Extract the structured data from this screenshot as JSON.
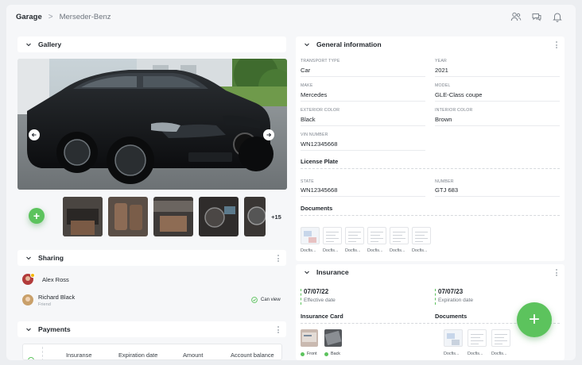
{
  "breadcrumb": {
    "root": "Garage",
    "separator": ">",
    "current": "Merseder-Benz"
  },
  "gallery": {
    "title": "Gallery",
    "more_count": "+15",
    "prev_icon": "arrow-left-icon",
    "next_icon": "arrow-right-icon"
  },
  "sharing": {
    "title": "Sharing",
    "people": [
      {
        "name": "Alex Ross",
        "role": ""
      },
      {
        "name": "Richard Black",
        "role": "Friend",
        "permission": "Can view"
      }
    ]
  },
  "payments": {
    "title": "Payments",
    "columns": [
      "Insuranse",
      "Expiration date",
      "Amount",
      "Account balance"
    ]
  },
  "general": {
    "title": "General information",
    "fields": {
      "transport_type": {
        "label": "TRANSPORT TYPE",
        "value": "Car"
      },
      "year": {
        "label": "YEAR",
        "value": "2021"
      },
      "make": {
        "label": "MAKE",
        "value": "Mercedes"
      },
      "model": {
        "label": "MODEL",
        "value": "GLE-Class coupe"
      },
      "exterior_color": {
        "label": "EXTERIOR COLOR",
        "value": "Black"
      },
      "interior_color": {
        "label": "INTERIOR COLOR",
        "value": "Brown"
      },
      "vin": {
        "label": "VIN NUMBER",
        "value": "WN12345668"
      }
    },
    "license_plate": {
      "title": "License Plate",
      "state": {
        "label": "STATE",
        "value": "WN12345668"
      },
      "number": {
        "label": "NUMBER",
        "value": "GTJ 683"
      }
    },
    "documents": {
      "title": "Documents",
      "files": [
        "Docfis...",
        "Docfis...",
        "Docfis...",
        "Docfis...",
        "Docfis...",
        "Docfis..."
      ]
    }
  },
  "insurance": {
    "title": "Insurance",
    "effective": {
      "date": "07/07/22",
      "label": "Effective date"
    },
    "expiration": {
      "date": "07/07/23",
      "label": "Expiration date"
    },
    "card": {
      "title": "Insurance Card",
      "front": "Front",
      "back": "Back"
    },
    "documents": {
      "title": "Documents",
      "files": [
        "Docfis...",
        "Docfis...",
        "Docfis..."
      ]
    }
  },
  "colors": {
    "accent": "#5cc35d",
    "text": "#23282e",
    "muted": "#7b828b"
  },
  "icons": [
    "users-icon",
    "chat-icon",
    "bell-icon",
    "plus-icon",
    "check-circle-icon",
    "chevron-down-icon",
    "more-vertical-icon"
  ]
}
